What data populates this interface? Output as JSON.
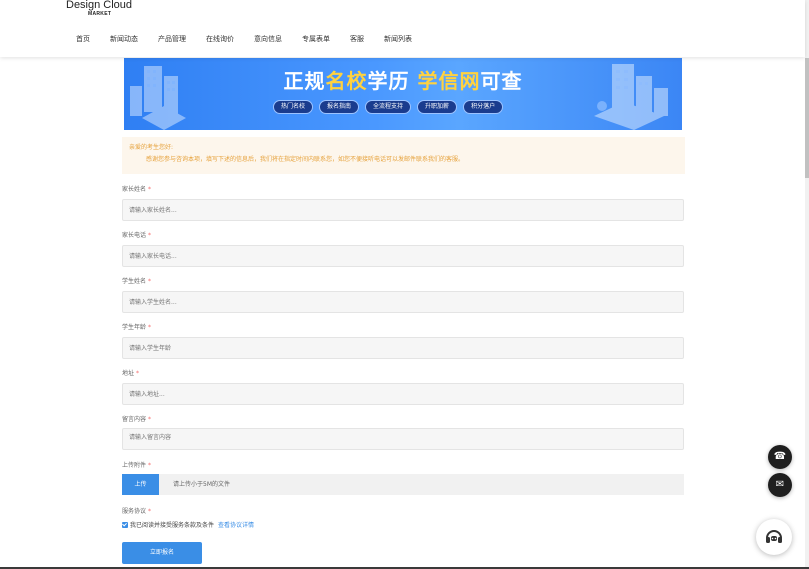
{
  "header": {
    "logo_main": "Design Cloud",
    "logo_sub": "MARKET",
    "nav": [
      "首页",
      "新闻动态",
      "产品管理",
      "在线询价",
      "意向信息",
      "专属表单",
      "客服",
      "新闻列表"
    ]
  },
  "banner": {
    "title_white_1": "正规",
    "title_yellow_1": "名校",
    "title_white_2": "学历 ",
    "title_yellow_2": "学信网",
    "title_white_3": "可查",
    "tags": [
      "热门名校",
      "报名指南",
      "全流程支持",
      "升职加薪",
      "积分落户"
    ]
  },
  "notice": {
    "title": "亲爱的考生您好:",
    "body": "感谢您参与咨询本项，填写下述的信息后，我们将在指定时间内联系您，如您不便接听电话可以发邮件联系我们的客服。"
  },
  "form": {
    "fields": [
      {
        "label": "家长姓名",
        "placeholder": "请输入家长姓名..."
      },
      {
        "label": "家长电话",
        "placeholder": "请输入家长电话..."
      },
      {
        "label": "学生姓名",
        "placeholder": "请输入学生姓名..."
      },
      {
        "label": "学生年龄",
        "placeholder": "请输入学生年龄"
      },
      {
        "label": "地址",
        "placeholder": "请输入地址..."
      },
      {
        "label": "留言内容",
        "placeholder": "请输入留言内容"
      }
    ],
    "upload_label": "上传附件",
    "upload_button": "上传",
    "upload_hint": "请上传小于5M的文件",
    "agreement_label": "服务协议",
    "agreement_text": "我已阅读并接受服务条款及条件",
    "agreement_link": "查看协议详情",
    "submit": "立即报名"
  },
  "floating": {
    "phone_icon": "☎",
    "mail_icon": "✉"
  },
  "colors": {
    "primary": "#3a8ee6",
    "required": "#f56c6c",
    "notice_text": "#e6a23c",
    "notice_bg": "#fdf6ec",
    "banner_yellow": "#ffd23f"
  }
}
